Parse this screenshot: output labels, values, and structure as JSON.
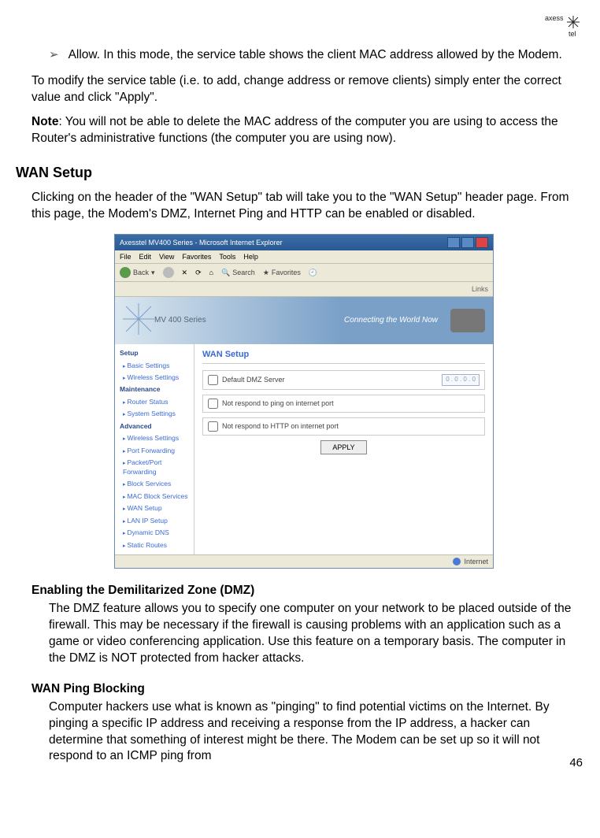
{
  "logo_text": "axess tel",
  "bullet": "Allow. In this mode, the service table shows the client MAC address allowed by the Modem.",
  "para_modify": "To modify the service table (i.e. to add, change address or remove clients) simply enter the correct value and click \"Apply\".",
  "note_label": "Note",
  "note_body": ": You will not be able to delete the MAC address of the computer you are using to access the Router's administrative functions (the computer you are using now).",
  "h_wan": "WAN Setup",
  "para_wan": "Clicking on the header of the \"WAN Setup\" tab will take you to the \"WAN Setup\" header page. From this page, the Modem's DMZ, Internet Ping and HTTP can be enabled or disabled.",
  "shot": {
    "title": "Axesstel MV400 Series - Microsoft Internet Explorer",
    "menu": [
      "File",
      "Edit",
      "View",
      "Favorites",
      "Tools",
      "Help"
    ],
    "toolbar": {
      "back": "Back",
      "search": "Search",
      "favorites": "Favorites"
    },
    "addr_right": "Links",
    "banner_prod": "MV 400 Series",
    "banner_tag": "Connecting the World Now",
    "sidebar": {
      "g1": "Setup",
      "g1_items": [
        "Basic Settings",
        "Wireless Settings"
      ],
      "g2": "Maintenance",
      "g2_items": [
        "Router Status",
        "System Settings"
      ],
      "g3": "Advanced",
      "g3_items": [
        "Wireless Settings",
        "Port Forwarding",
        "Packet/Port Forwarding",
        "Block Services",
        "MAC Block Services",
        "WAN Setup",
        "LAN IP Setup",
        "Dynamic DNS",
        "Static Routes"
      ]
    },
    "pane_title": "WAN Setup",
    "row1": "Default DMZ Server",
    "row1_ip": "0 . 0 . 0 . 0",
    "row2": "Not respond to ping on internet port",
    "row3": "Not respond to HTTP on internet port",
    "apply": "APPLY",
    "status": "Internet"
  },
  "h_dmz": "Enabling the Demilitarized Zone (DMZ)",
  "p_dmz": "The DMZ feature allows you to specify one computer on your network to be placed outside of the firewall. This may be necessary if the firewall is causing problems with an application such as a game or video conferencing application. Use this feature on a temporary basis. The computer in the DMZ is NOT protected from hacker attacks.",
  "h_ping": "WAN Ping Blocking",
  "p_ping": "Computer hackers use what is known as \"pinging\" to find potential victims on the Internet. By pinging a specific IP address and receiving a response from the IP address, a hacker can determine that something of interest might be there. The Modem can be set up so it will not respond to an ICMP ping from",
  "page_number": "46"
}
